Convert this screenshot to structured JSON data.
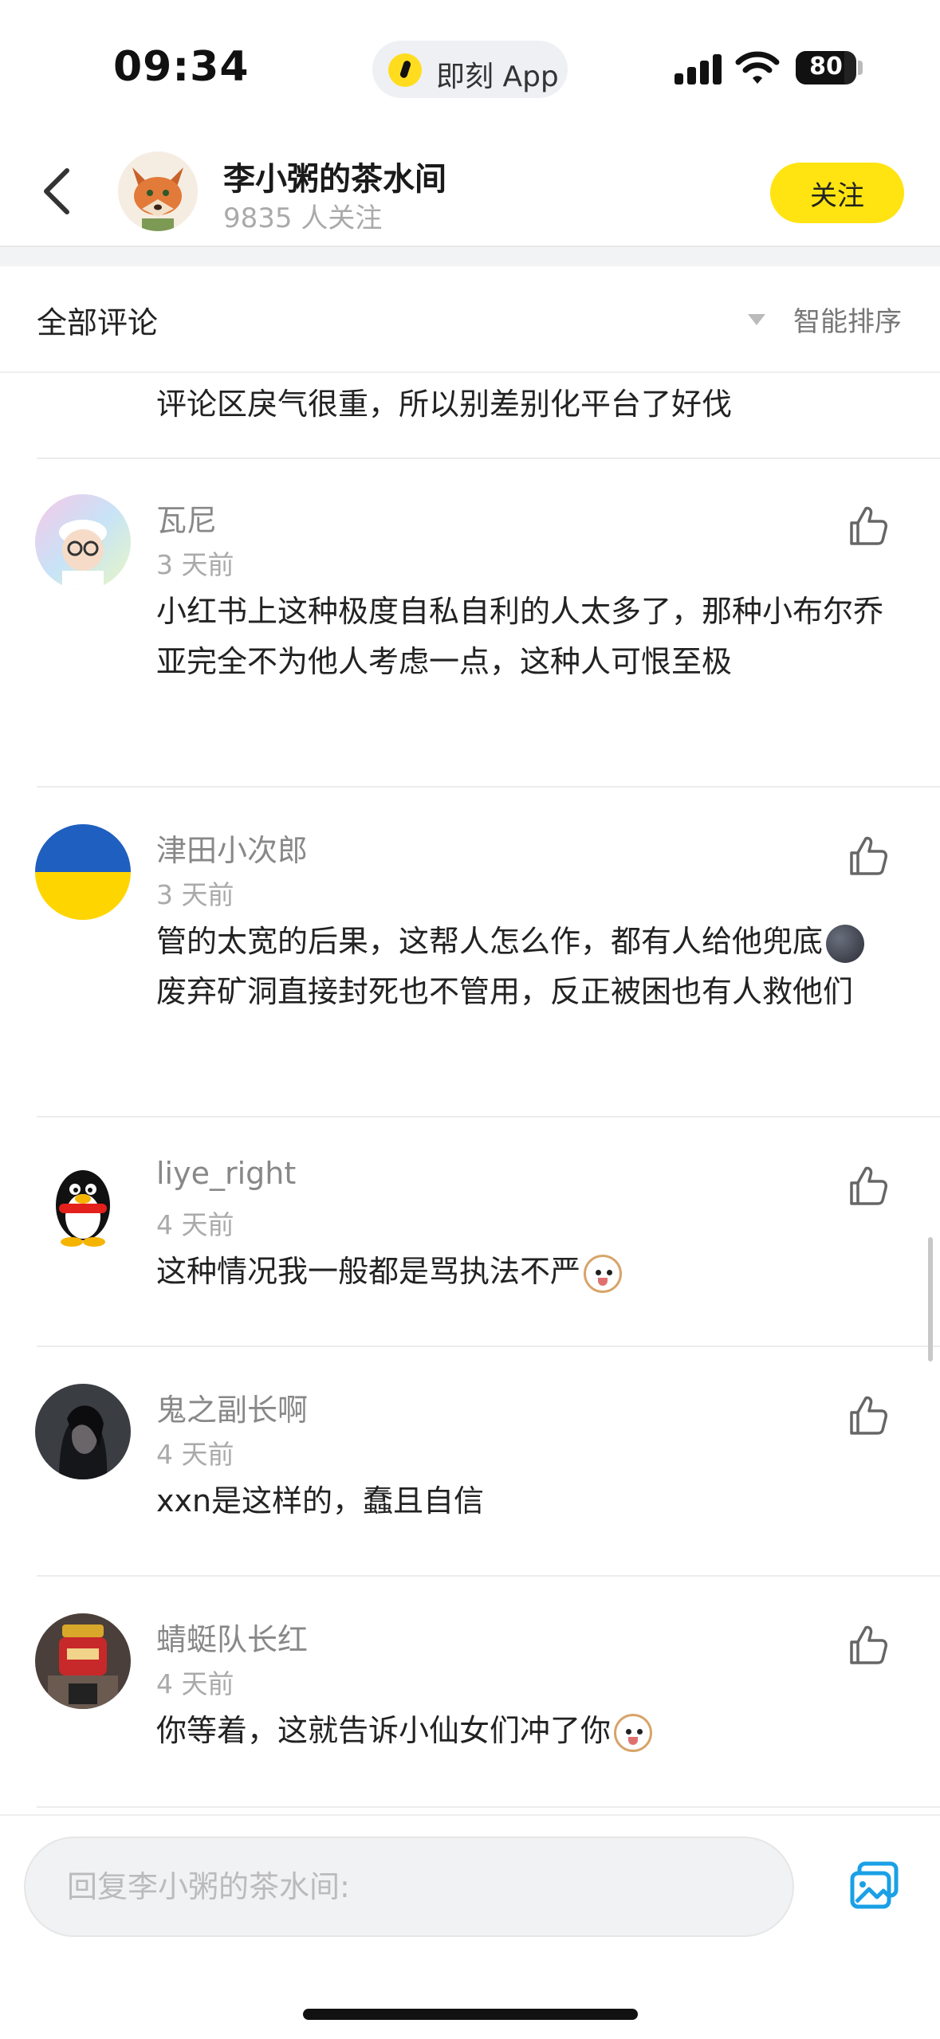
{
  "status_bar": {
    "time": "09:34",
    "app_label": "即刻 App",
    "battery": "80"
  },
  "header": {
    "title": "李小粥的茶水间",
    "followers": "9835 人关注",
    "follow_label": "关注"
  },
  "sort_bar": {
    "label": "全部评论",
    "sort_label": "智能排序"
  },
  "partial_comment": "评论区戾气很重，所以别差别化平台了好伐",
  "comments": [
    {
      "user": "瓦尼",
      "time": "3 天前",
      "text": "小红书上这种极度自私自利的人太多了，那种小布尔乔亚完全不为他人考虑一点，这种人可恨至极"
    },
    {
      "user": "津田小次郎",
      "time": "3 天前",
      "text_a": "管的太宽的后果，这帮人怎么作，都有人给他兜底",
      "text_b": "废弃矿洞直接封死也不管用，反正被困也有人救他们"
    },
    {
      "user": "liye_right",
      "time": "4 天前",
      "text": "这种情况我一般都是骂执法不严"
    },
    {
      "user": "鬼之副长啊",
      "time": "4 天前",
      "text": "xxn是这样的，蠢且自信"
    },
    {
      "user": "蜻蜓队长红",
      "time": "4 天前",
      "text": "你等着，这就告诉小仙女们冲了你"
    }
  ],
  "reply_box": {
    "placeholder": "回复李小粥的茶水间:"
  }
}
